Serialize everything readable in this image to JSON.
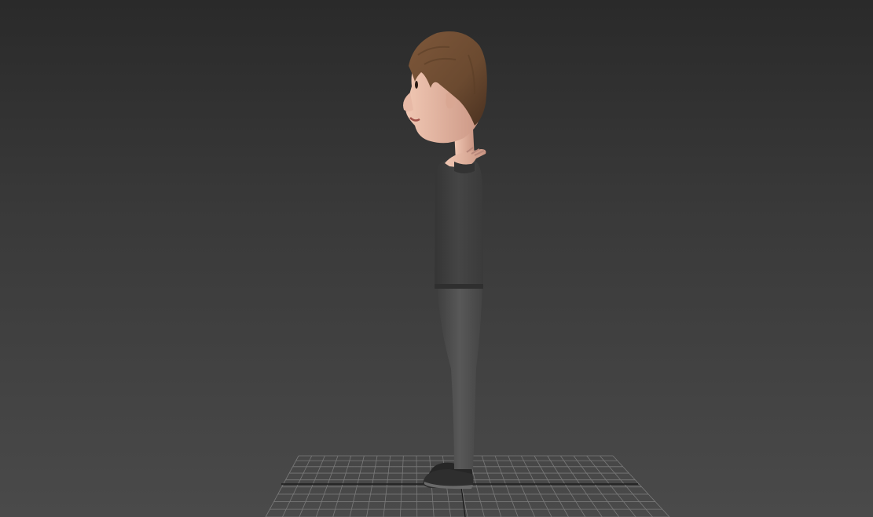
{
  "viewport": {
    "background_top": "#2a2a2a",
    "background_bottom": "#4a4a4a",
    "grid_color": "#7a7a7a",
    "grid_axis_color": "#1a1a1a"
  },
  "character": {
    "hair_color": "#6b4a30",
    "skin_color": "#e2b4a0",
    "shirt_color": "#3f3f3f",
    "pants_color": "#4c4c4c",
    "shoe_color": "#2b2b2b"
  }
}
